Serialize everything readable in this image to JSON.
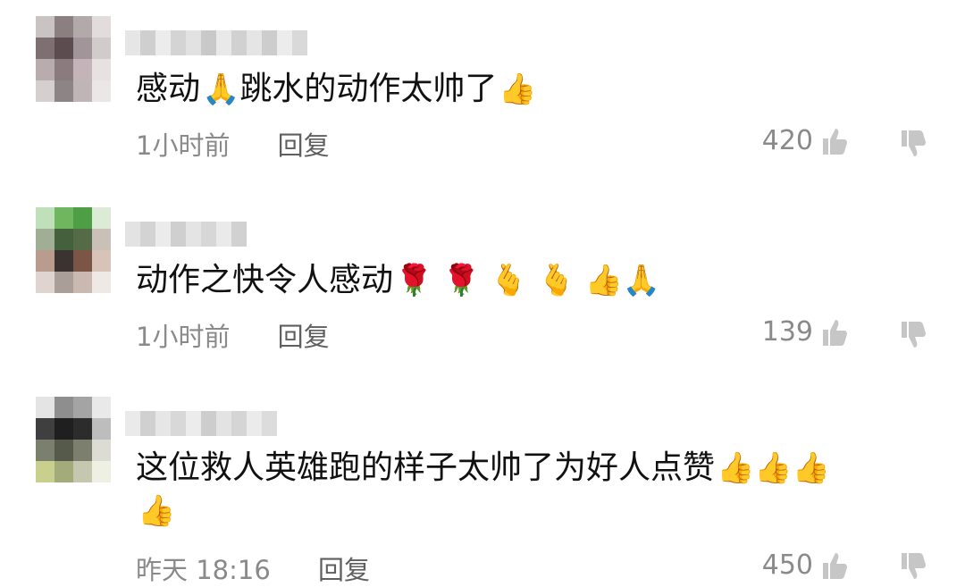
{
  "comments": [
    {
      "text": "感动",
      "emoji_after_first": "🙏",
      "text2": "跳水的动作太帅了",
      "emoji_end": "👍",
      "time": "1小时前",
      "reply_label": "回复",
      "like_count": "420"
    },
    {
      "text": "动作之快令人感动",
      "emojis": "🌹 🌹 🫰 🫰 👍🙏",
      "time": "1小时前",
      "reply_label": "回复",
      "like_count": "139"
    },
    {
      "text": "这位救人英雄跑的样子太帅了为好人点赞",
      "emojis": "👍👍👍",
      "emojis_line2": "👍",
      "time": "昨天 18:16",
      "reply_label": "回复",
      "like_count": "450"
    }
  ],
  "icons": {
    "like": "thumbs-up-outline-icon",
    "dislike": "thumbs-down-outline-icon"
  },
  "colors": {
    "text": "#111111",
    "meta": "#8a8a8a",
    "reply": "#5f5f5f"
  }
}
